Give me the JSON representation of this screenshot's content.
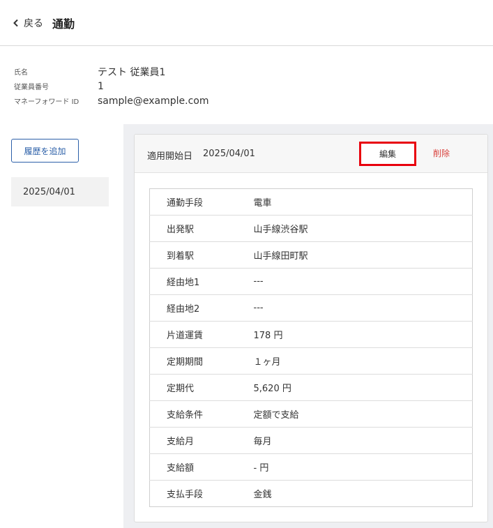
{
  "header": {
    "back_label": "戻る",
    "title": "通勤"
  },
  "employee": {
    "rows": [
      {
        "label": "氏名",
        "value": "テスト 従業員1"
      },
      {
        "label": "従業員番号",
        "value": "1"
      },
      {
        "label": "マネーフォワード ID",
        "value": "sample@example.com"
      }
    ]
  },
  "sidebar": {
    "add_history_label": "履歴を追加",
    "history_items": [
      "2025/04/01"
    ]
  },
  "card": {
    "start_date_label": "適用開始日",
    "start_date_value": "2025/04/01",
    "edit_label": "編集",
    "delete_label": "削除",
    "rows": [
      {
        "label": "通勤手段",
        "value": "電車"
      },
      {
        "label": "出発駅",
        "value": "山手線渋谷駅"
      },
      {
        "label": "到着駅",
        "value": "山手線田町駅"
      },
      {
        "label": "経由地1",
        "value": "---"
      },
      {
        "label": "経由地2",
        "value": "---"
      },
      {
        "label": "片道運賃",
        "value": "178 円"
      },
      {
        "label": "定期期間",
        "value": "１ヶ月"
      },
      {
        "label": "定期代",
        "value": "5,620 円"
      },
      {
        "label": "支給条件",
        "value": "定額で支給"
      },
      {
        "label": "支給月",
        "value": "毎月"
      },
      {
        "label": "支給額",
        "value": "- 円"
      },
      {
        "label": "支払手段",
        "value": "金銭"
      }
    ]
  },
  "colors": {
    "primary_blue": "#2b5fa8",
    "delete_red": "#d9413c",
    "highlight_red": "#e8000d",
    "panel_bg": "#eeeff2"
  },
  "icons": {
    "back": "chevron-left-icon"
  }
}
